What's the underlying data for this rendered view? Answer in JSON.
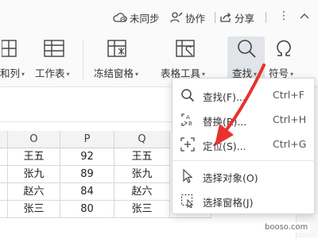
{
  "top": {
    "unsynced_label": "未同步",
    "collab_label": "协作",
    "share_label": "分享",
    "more_glyph": "⋮"
  },
  "ribbon": {
    "col_label": "和列",
    "worksheet_label": "工作表",
    "freeze_label": "冻结窗格",
    "table_tools_label": "表格工具",
    "find_label": "查找",
    "symbol_label": "符号",
    "dropdown_arrow": "▾"
  },
  "grid": {
    "columns": [
      "O",
      "P",
      "Q"
    ],
    "rows": [
      [
        "王五",
        "92",
        "王五"
      ],
      [
        "张九",
        "89",
        "张九"
      ],
      [
        "赵六",
        "84",
        "赵六"
      ],
      [
        "张三",
        "80",
        "张三"
      ]
    ],
    "overflow_value_last": "80"
  },
  "menu": {
    "items": [
      {
        "label": "查找(F)...",
        "shortcut": "Ctrl+F",
        "icon": "search-icon"
      },
      {
        "label": "替换(R)...",
        "shortcut": "Ctrl+H",
        "icon": "replace-icon"
      },
      {
        "label": "定位(S)...",
        "shortcut": "Ctrl+G",
        "icon": "locate-icon"
      },
      {
        "label": "选择对象(O)",
        "shortcut": "",
        "icon": "select-cursor-icon"
      },
      {
        "label": "选择窗格(J)",
        "shortcut": "",
        "icon": "selection-pane-icon"
      }
    ]
  },
  "watermark": "booso.com",
  "colors": {
    "accent_red": "#e8322d",
    "menu_border": "#d8d8d8",
    "active_bg": "#e1e4e8"
  }
}
